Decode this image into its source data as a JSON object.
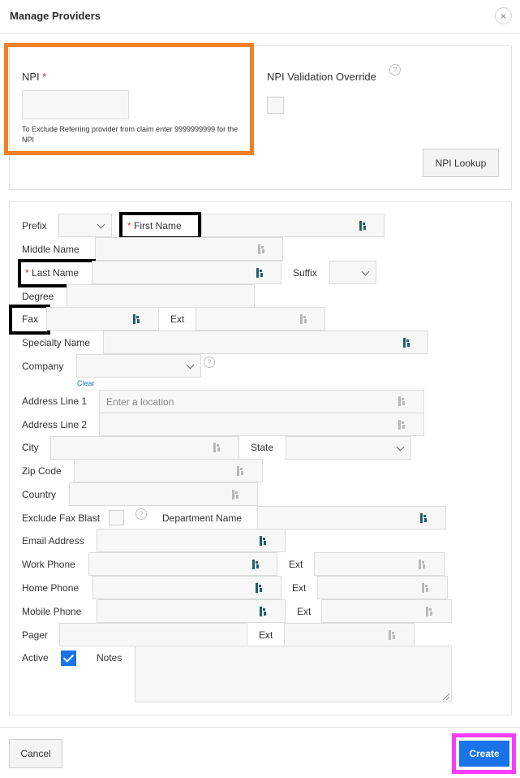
{
  "dialog": {
    "title": "Manage Providers",
    "close_icon": "×"
  },
  "npi": {
    "label": "NPI",
    "required_mark": "*",
    "value": "",
    "hint": "To Exclude Referring provider from claim enter 9999999999 for the NPI",
    "override_label": "NPI Validation Override",
    "override_checked": false,
    "lookup_button": "NPI Lookup"
  },
  "form": {
    "prefix_label": "Prefix",
    "prefix_value": "",
    "first_name_label": "First Name",
    "first_name_value": "",
    "middle_name_label": "Middle Name",
    "middle_name_value": "",
    "last_name_label": "Last Name",
    "last_name_value": "",
    "suffix_label": "Suffix",
    "suffix_value": "",
    "degree_label": "Degree",
    "degree_value": "",
    "fax_label": "Fax",
    "fax_value": "",
    "fax_ext_label": "Ext",
    "fax_ext_value": "",
    "specialty_label": "Specialty Name",
    "specialty_value": "",
    "company_label": "Company",
    "company_value": "",
    "company_clear": "Clear",
    "address1_label": "Address Line 1",
    "address1_placeholder": "Enter a location",
    "address2_label": "Address Line 2",
    "address2_value": "",
    "city_label": "City",
    "city_value": "",
    "state_label": "State",
    "state_value": "",
    "zip_label": "Zip Code",
    "zip_value": "",
    "country_label": "Country",
    "country_value": "",
    "exclude_fax_label": "Exclude Fax Blast",
    "exclude_fax_checked": false,
    "department_label": "Department Name",
    "department_value": "",
    "email_label": "Email Address",
    "email_value": "",
    "work_phone_label": "Work Phone",
    "work_phone_value": "",
    "work_ext_label": "Ext",
    "work_ext_value": "",
    "home_phone_label": "Home Phone",
    "home_phone_value": "",
    "home_ext_label": "Ext",
    "home_ext_value": "",
    "mobile_phone_label": "Mobile Phone",
    "mobile_phone_value": "",
    "mobile_ext_label": "Ext",
    "mobile_ext_value": "",
    "pager_label": "Pager",
    "pager_value": "",
    "pager_ext_label": "Ext",
    "pager_ext_value": "",
    "active_label": "Active",
    "active_checked": true,
    "notes_label": "Notes",
    "notes_value": ""
  },
  "footer": {
    "cancel_button": "Cancel",
    "create_button": "Create"
  },
  "colors": {
    "accent": "#1a73e8",
    "highlight_orange": "#f58024",
    "highlight_pink": "#f53cff",
    "required": "#d32f2f"
  }
}
